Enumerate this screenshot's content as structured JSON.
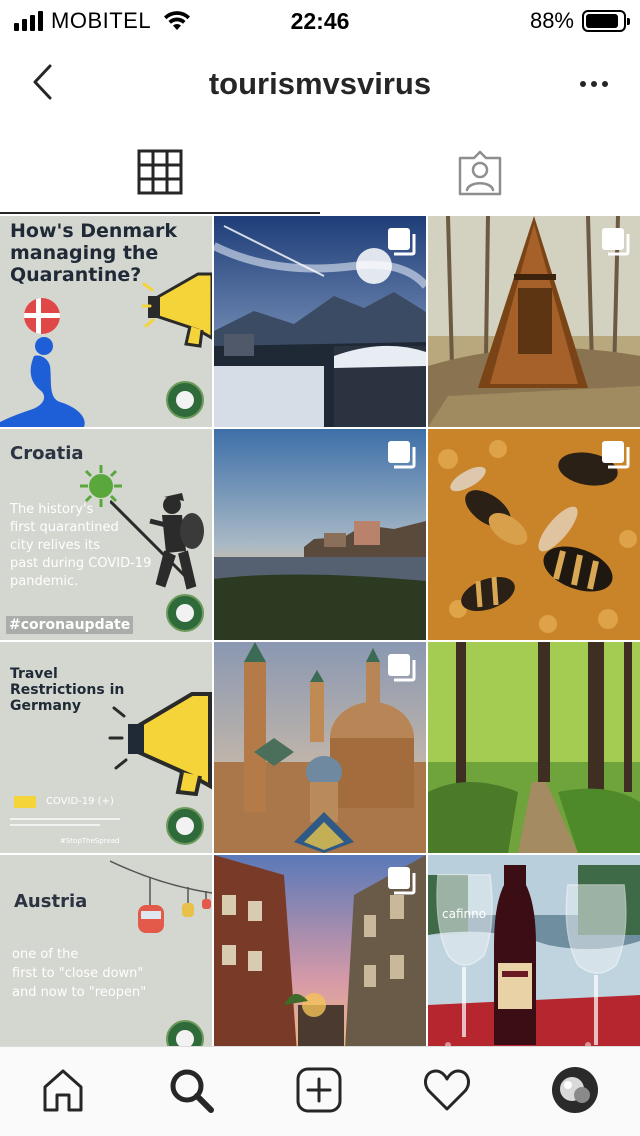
{
  "status_bar": {
    "carrier": "MOBITEL",
    "time": "22:46",
    "battery": "88%",
    "battery_level": 0.88
  },
  "header": {
    "title": "tourismvsvirus",
    "back_icon": "chevron-left-icon",
    "more_icon": "more-horizontal-icon"
  },
  "tabs": [
    {
      "name": "grid",
      "icon": "grid-icon",
      "active": true
    },
    {
      "name": "tagged",
      "icon": "tagged-person-icon",
      "active": false
    }
  ],
  "posts": [
    {
      "type": "graphic",
      "title": "How's Denmark managing the Quarantine?"
    },
    {
      "type": "photo",
      "multi": true,
      "description_icon": "mountain-village-photo"
    },
    {
      "type": "photo",
      "multi": true,
      "description_icon": "wooden-hut-photo"
    },
    {
      "type": "graphic",
      "title": "Croatia",
      "body": [
        "The history's",
        "first quarantined",
        "city relives its",
        "past during COVID-19",
        "pandemic."
      ],
      "tag": "#coronaupdate"
    },
    {
      "type": "photo",
      "multi": true,
      "description_icon": "sunset-bay-photo"
    },
    {
      "type": "photo",
      "multi": true,
      "description_icon": "bees-photo"
    },
    {
      "type": "graphic",
      "title": "Travel Restrictions in Germany",
      "legend": "COVID-19 (+)",
      "hashtag": "#StopTheSpread"
    },
    {
      "type": "photo",
      "multi": true,
      "description_icon": "cathedral-photo"
    },
    {
      "type": "photo",
      "multi": false,
      "description_icon": "forest-path-photo"
    },
    {
      "type": "graphic",
      "title": "Austria",
      "body": [
        "one of the",
        "first to \"close down\"",
        "and now to \"reopen\""
      ]
    },
    {
      "type": "photo",
      "multi": true,
      "description_icon": "old-town-street-photo"
    },
    {
      "type": "photo",
      "multi": false,
      "description_icon": "wine-glasses-photo",
      "glass_text": "cafinno"
    }
  ],
  "bottom_bar": [
    {
      "name": "home",
      "icon": "home-icon"
    },
    {
      "name": "search",
      "icon": "search-icon"
    },
    {
      "name": "new-post",
      "icon": "add-post-icon"
    },
    {
      "name": "activity",
      "icon": "heart-icon"
    },
    {
      "name": "profile",
      "icon": "profile-avatar"
    }
  ]
}
